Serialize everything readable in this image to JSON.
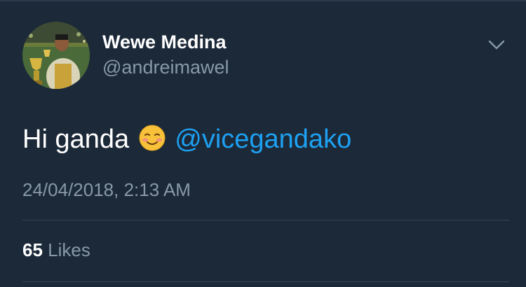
{
  "tweet": {
    "author": {
      "display_name": "Wewe Medina",
      "handle": "@andreimawel",
      "avatar_icon": "profile-photo"
    },
    "menu_icon": "chevron-down-icon",
    "text_before": "Hi ganda",
    "emoji_icon": "smiling-face-emoji",
    "mention": "@vicegandako",
    "timestamp": "24/04/2018, 2:13 AM",
    "likes_count": "65",
    "likes_label": "Likes"
  },
  "colors": {
    "background": "#1c2938",
    "secondary_text": "#8899a6",
    "mention": "#1da1f2",
    "divider": "#38444d"
  }
}
